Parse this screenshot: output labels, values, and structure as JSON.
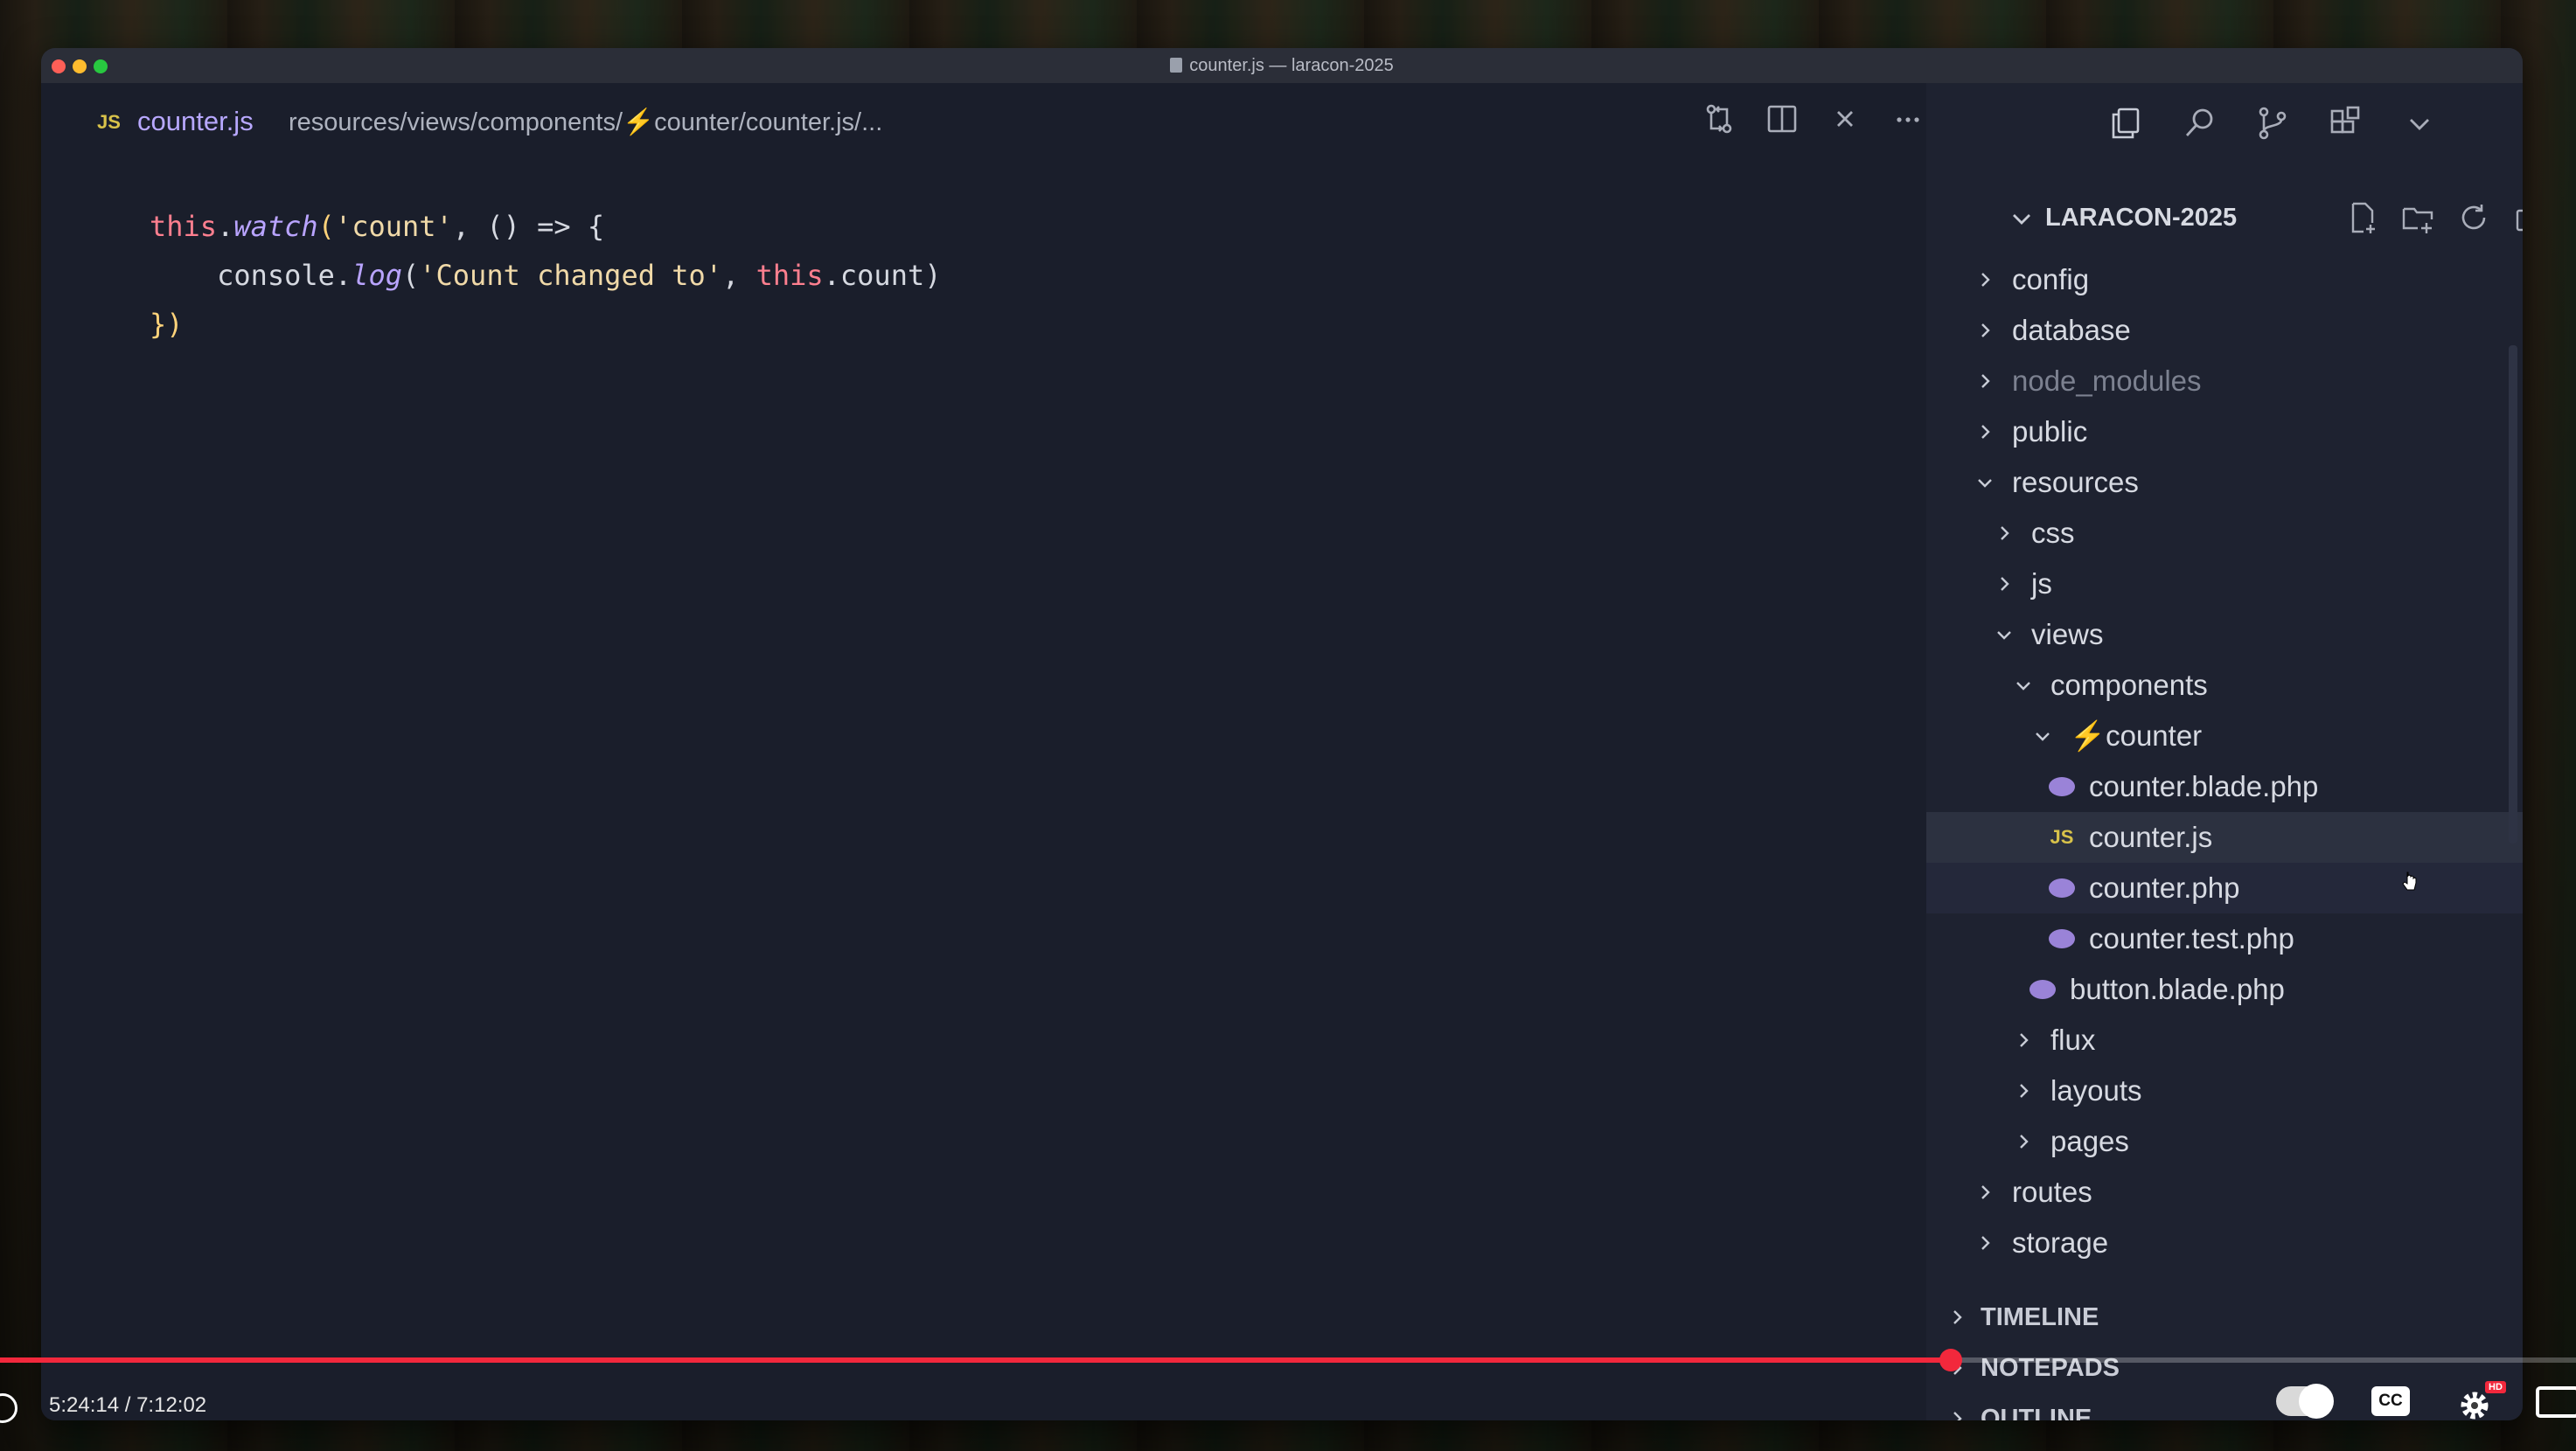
{
  "window": {
    "title": "counter.js — laracon-2025"
  },
  "editor": {
    "tab": {
      "badge": "JS",
      "filename": "counter.js",
      "path": "resources/views/components/⚡counter/counter.js/..."
    },
    "icons": [
      "compare-changes-icon",
      "split-editor-icon",
      "close-icon",
      "more-actions-icon"
    ],
    "code": {
      "line1": {
        "kw": "this",
        "dot": ".",
        "fn": "watch",
        "open": "(",
        "str": "'count'",
        "rest": ", () => {"
      },
      "line2": {
        "plain": "console.",
        "fn": "log",
        "open": "(",
        "str": "'Count changed to'",
        "comma": ", ",
        "kw": "this",
        "rest": ".count)"
      },
      "line3": {
        "text": "})"
      }
    }
  },
  "sidebar": {
    "activity_icons": [
      "explorer-icon",
      "search-icon",
      "source-control-icon",
      "extensions-icon",
      "chevron-down-icon"
    ],
    "explorer": {
      "root_label": "LARACON-2025",
      "actions": [
        "new-file-icon",
        "new-folder-icon",
        "refresh-icon",
        "collapse-all-icon"
      ]
    },
    "tree": [
      {
        "label": "config",
        "type": "folder",
        "expanded": false,
        "depth": 0
      },
      {
        "label": "database",
        "type": "folder",
        "expanded": false,
        "depth": 0
      },
      {
        "label": "node_modules",
        "type": "folder",
        "expanded": false,
        "depth": 0,
        "muted": true
      },
      {
        "label": "public",
        "type": "folder",
        "expanded": false,
        "depth": 0
      },
      {
        "label": "resources",
        "type": "folder",
        "expanded": true,
        "depth": 0
      },
      {
        "label": "css",
        "type": "folder",
        "expanded": false,
        "depth": 1
      },
      {
        "label": "js",
        "type": "folder",
        "expanded": false,
        "depth": 1
      },
      {
        "label": "views",
        "type": "folder",
        "expanded": true,
        "depth": 1
      },
      {
        "label": "components",
        "type": "folder",
        "expanded": true,
        "depth": 2
      },
      {
        "label": "⚡counter",
        "type": "folder",
        "expanded": true,
        "depth": 3
      },
      {
        "label": "counter.blade.php",
        "type": "php",
        "depth": 4
      },
      {
        "label": "counter.js",
        "type": "js",
        "depth": 4,
        "selected": true
      },
      {
        "label": "counter.php",
        "type": "php",
        "depth": 4,
        "hover": true
      },
      {
        "label": "counter.test.php",
        "type": "php",
        "depth": 4
      },
      {
        "label": "button.blade.php",
        "type": "php",
        "depth": 3
      },
      {
        "label": "flux",
        "type": "folder",
        "expanded": false,
        "depth": 2
      },
      {
        "label": "layouts",
        "type": "folder",
        "expanded": false,
        "depth": 2
      },
      {
        "label": "pages",
        "type": "folder",
        "expanded": false,
        "depth": 2
      },
      {
        "label": "routes",
        "type": "folder",
        "expanded": false,
        "depth": 0
      },
      {
        "label": "storage",
        "type": "folder",
        "expanded": false,
        "depth": 0
      }
    ],
    "sections": {
      "timeline": "TIMELINE",
      "notepads": "NOTEPADS",
      "outline": "OUTLINE"
    }
  },
  "video": {
    "time": "5:24:14 / 7:12:02",
    "progress": 0.7573,
    "cc_label": "CC",
    "hd_badge": "HD"
  },
  "colors": {
    "editor_bg": "#1a1e2b",
    "sidebar_bg": "#1e2230",
    "keyword": "#ff7f8f",
    "function": "#b9a4ff",
    "string": "#f0d9a8",
    "progress": "#f2283c"
  }
}
